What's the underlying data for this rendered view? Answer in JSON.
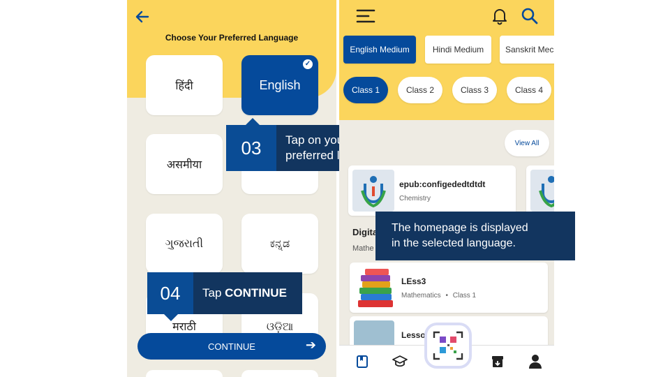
{
  "left": {
    "title": "Choose Your Preferred Language",
    "languages": [
      {
        "label": "हिंदी",
        "selected": false
      },
      {
        "label": "English",
        "selected": true
      },
      {
        "label": "असमीया",
        "selected": false
      },
      {
        "label": "",
        "selected": false
      },
      {
        "label": "ગુજરાતી",
        "selected": false
      },
      {
        "label": "ಕನ್ನಡ",
        "selected": false
      },
      {
        "label": "मराठी",
        "selected": false
      },
      {
        "label": "ଓଡ଼ିଆ",
        "selected": false
      }
    ],
    "continue_label": "CONTINUE"
  },
  "callouts": [
    {
      "num": "03",
      "text_line1": "Tap on your",
      "text_line2": "preferred language"
    },
    {
      "num": "04",
      "text_prefix": "Tap ",
      "text_bold": "CONTINUE"
    },
    {
      "text_line1": "The homepage is displayed",
      "text_line2": "in the selected language."
    }
  ],
  "right": {
    "mediums": [
      "English Medium",
      "Hindi Medium",
      "Sanskrit Mec"
    ],
    "classes": [
      "Class 1",
      "Class 2",
      "Class 3",
      "Class 4"
    ],
    "view_all": "View All",
    "card1": {
      "title": "epub:configededtdtdt",
      "subject": "Chemistry"
    },
    "section_title": "Digita",
    "section_sub": "Mathe",
    "item1": {
      "title": "LEss3",
      "subject": "Mathematics",
      "class": "Class 1"
    },
    "item2": {
      "title": "Lessor"
    }
  },
  "colors": {
    "brand_blue": "#054a9b",
    "yellow": "#fbd55c",
    "callout_dark": "#12355f"
  }
}
